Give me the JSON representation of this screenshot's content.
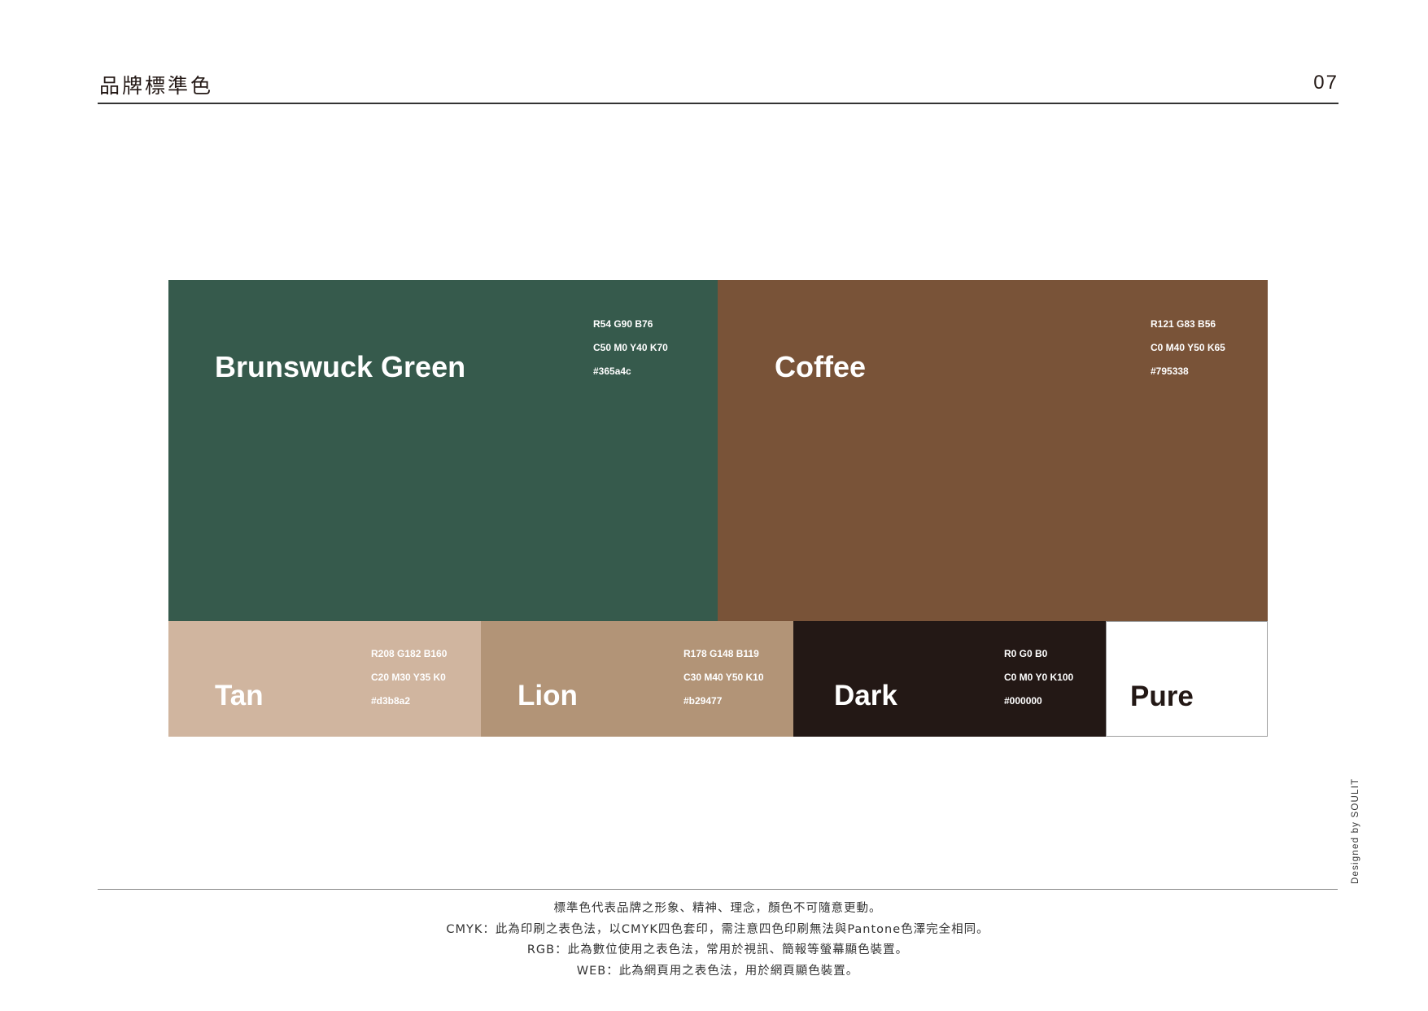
{
  "header": {
    "title": "品牌標準色",
    "page_number": "07"
  },
  "colors": {
    "brunswick_green": {
      "name": "Brunswuck Green",
      "rgb": "R54 G90 B76",
      "cmyk": "C50 M0 Y40 K70",
      "hex": "#365a4c",
      "swatch_color": "#365a4c"
    },
    "coffee": {
      "name": "Coffee",
      "rgb": "R121 G83 B56",
      "cmyk": "C0 M40 Y50 K65",
      "hex": "#795338",
      "swatch_color": "#795338"
    },
    "tan": {
      "name": "Tan",
      "rgb": "R208 G182 B160",
      "cmyk": "C20 M30 Y35 K0",
      "hex": "#d3b8a2",
      "swatch_color": "#d0b59f"
    },
    "lion": {
      "name": "Lion",
      "rgb": "R178 G148 B119",
      "cmyk": "C30 M40 Y50 K10",
      "hex": "#b29477",
      "swatch_color": "#b29477"
    },
    "dark": {
      "name": "Dark",
      "rgb": "R0 G0 B0",
      "cmyk": "C0 M0 Y0 K100",
      "hex": "#000000",
      "swatch_color": "#231815"
    },
    "pure": {
      "name": "Pure",
      "swatch_color": "#ffffff",
      "text_color": "#231815",
      "border_color": "#9e9e9e"
    }
  },
  "notes": [
    "標準色代表品牌之形象、精神、理念，顏色不可隨意更動。",
    "CMYK：此為印刷之表色法，以CMYK四色套印，需注意四色印刷無法與Pantone色澤完全相同。",
    "RGB：此為數位使用之表色法，常用於視訊、簡報等螢幕顯色裝置。",
    "WEB：此為網頁用之表色法，用於網頁顯色裝置。"
  ],
  "credit": "Designed by SOULIT"
}
